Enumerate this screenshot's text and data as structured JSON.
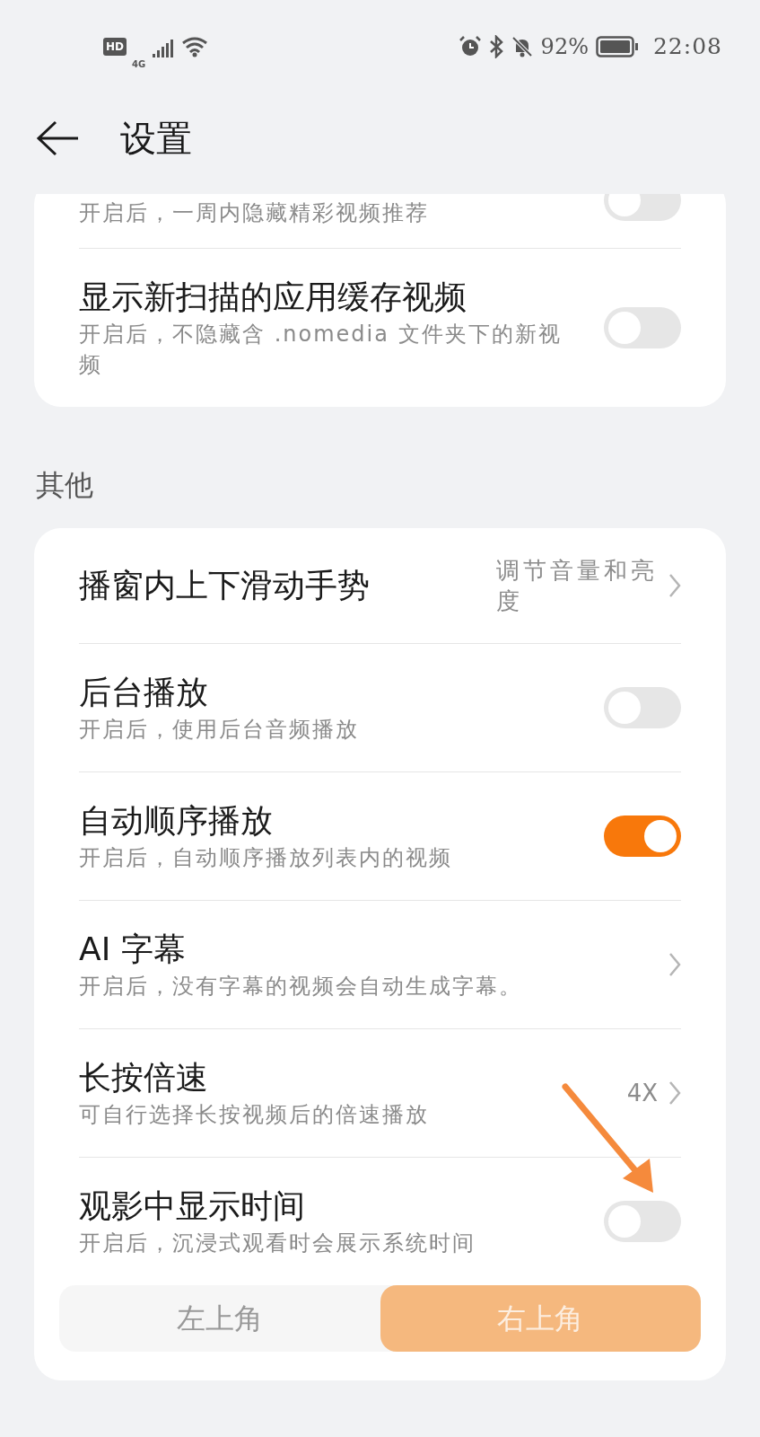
{
  "status_bar": {
    "hd": "HD",
    "network": "4G",
    "battery": "92%",
    "time": "22:08"
  },
  "header": {
    "title": "设置"
  },
  "top_card": {
    "items": [
      {
        "kind": "toggle",
        "subtitle": "开启后，一周内隐藏精彩视频推荐",
        "on": false
      },
      {
        "kind": "toggle",
        "title": "显示新扫描的应用缓存视频",
        "subtitle": "开启后，不隐藏含 .nomedia 文件夹下的新视频",
        "on": false
      }
    ]
  },
  "section": {
    "title": "其他"
  },
  "card": {
    "items": [
      {
        "kind": "link",
        "title": "播窗内上下滑动手势",
        "value": "调节音量和亮度"
      },
      {
        "kind": "toggle",
        "title": "后台播放",
        "subtitle": "开启后，使用后台音频播放",
        "on": false
      },
      {
        "kind": "toggle",
        "title": "自动顺序播放",
        "subtitle": "开启后，自动顺序播放列表内的视频",
        "on": true
      },
      {
        "kind": "link",
        "title": "AI 字幕",
        "subtitle": "开启后，没有字幕的视频会自动生成字幕。"
      },
      {
        "kind": "link",
        "title": "长按倍速",
        "value": "4X",
        "subtitle": "可自行选择长按视频后的倍速播放"
      },
      {
        "kind": "toggle",
        "title": "观影中显示时间",
        "subtitle": "开启后，沉浸式观看时会展示系统时间",
        "on": false
      }
    ],
    "position": {
      "disabled": true,
      "options": [
        {
          "label": "左上角",
          "selected": false
        },
        {
          "label": "右上角",
          "selected": true
        }
      ]
    }
  }
}
